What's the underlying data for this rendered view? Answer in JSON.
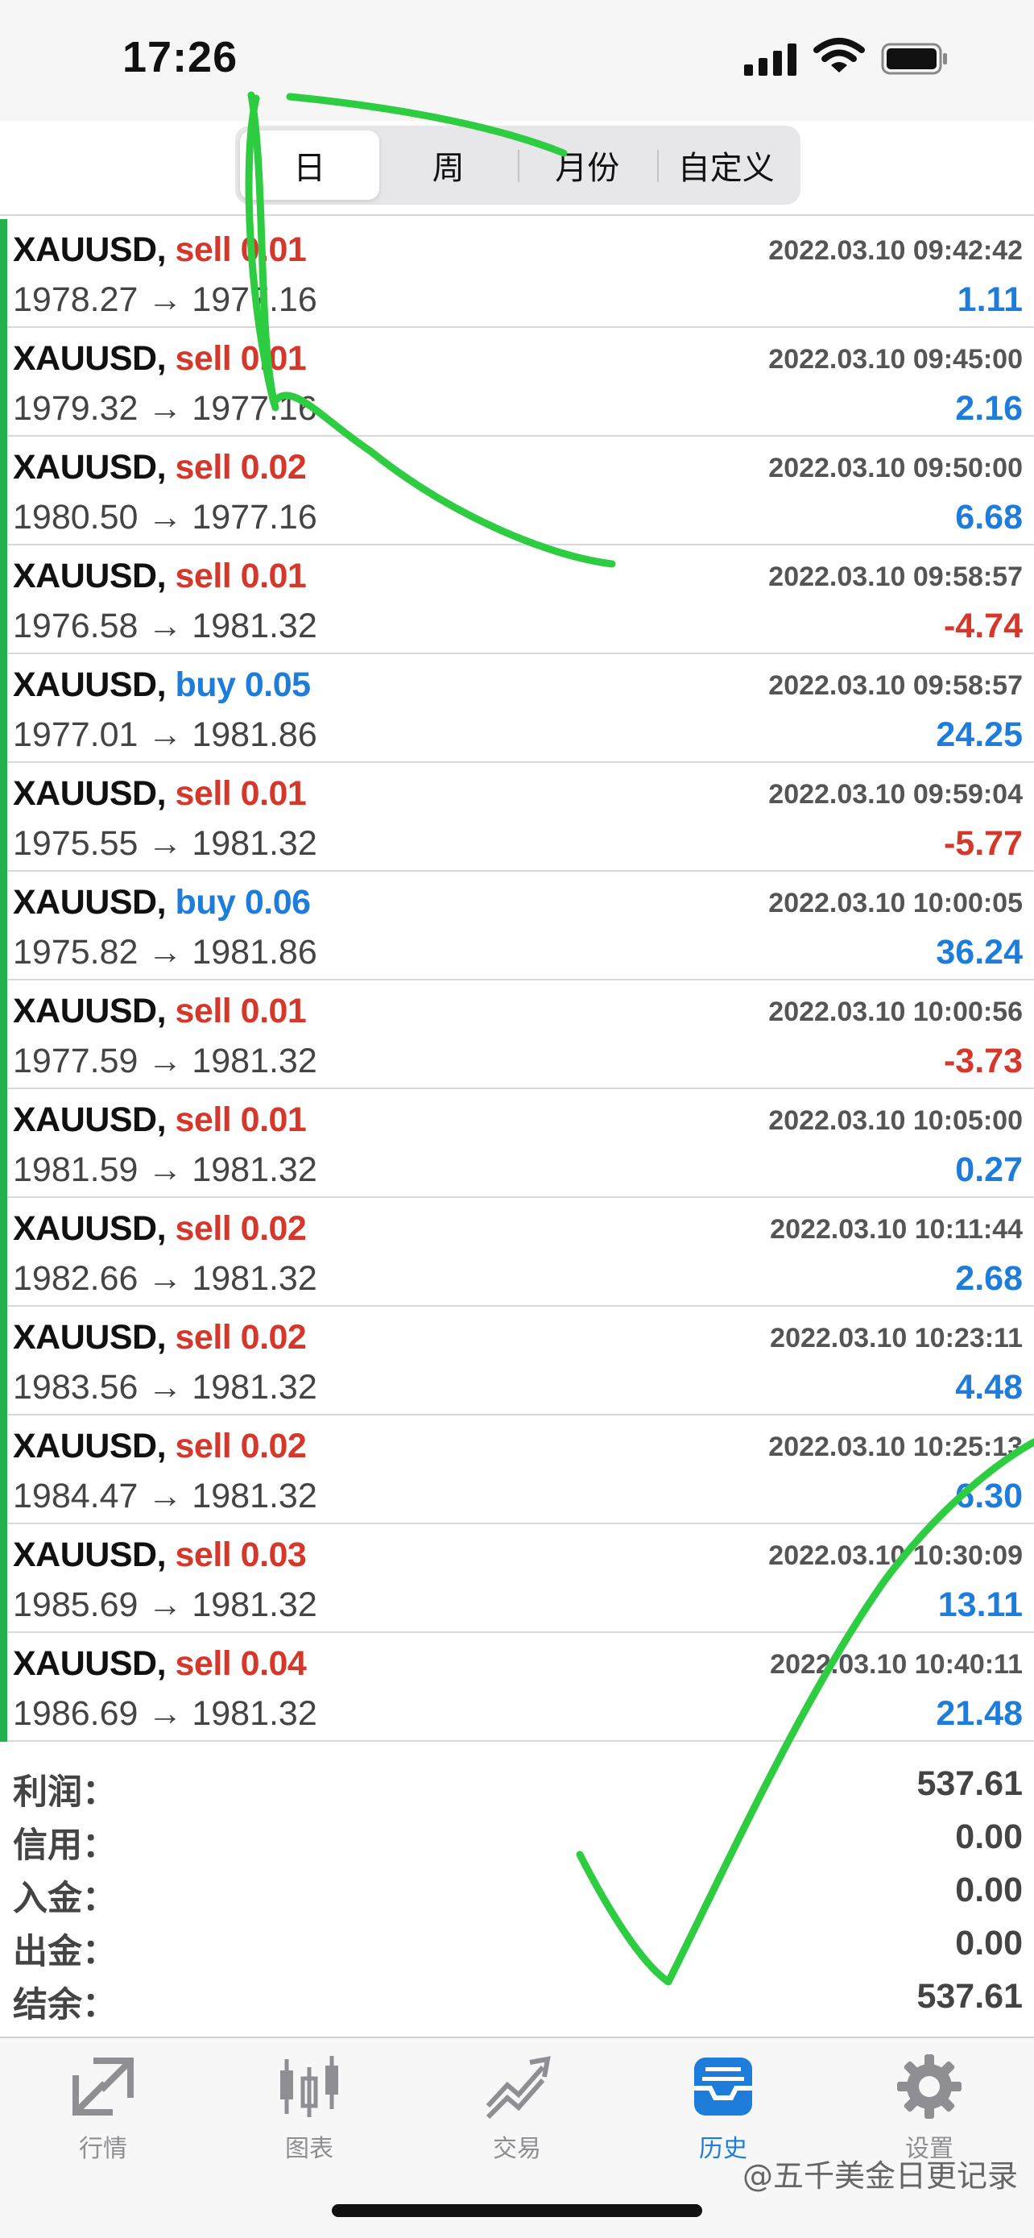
{
  "status_bar": {
    "time": "17:26"
  },
  "period_tabs": [
    {
      "label": "日",
      "active": true
    },
    {
      "label": "周",
      "active": false
    },
    {
      "label": "月份",
      "active": false
    },
    {
      "label": "自定义",
      "active": false
    }
  ],
  "trades": [
    {
      "symbol": "XAUUSD,",
      "side": "sell",
      "lots": "sell 0.01",
      "prices": "1978.27 → 1977.16",
      "time": "2022.03.10 09:42:42",
      "profit": "1.11"
    },
    {
      "symbol": "XAUUSD,",
      "side": "sell",
      "lots": "sell 0.01",
      "prices": "1979.32 → 1977.16",
      "time": "2022.03.10 09:45:00",
      "profit": "2.16"
    },
    {
      "symbol": "XAUUSD,",
      "side": "sell",
      "lots": "sell 0.02",
      "prices": "1980.50 → 1977.16",
      "time": "2022.03.10 09:50:00",
      "profit": "6.68"
    },
    {
      "symbol": "XAUUSD,",
      "side": "sell",
      "lots": "sell 0.01",
      "prices": "1976.58 → 1981.32",
      "time": "2022.03.10 09:58:57",
      "profit": "-4.74"
    },
    {
      "symbol": "XAUUSD,",
      "side": "buy",
      "lots": "buy 0.05",
      "prices": "1977.01 → 1981.86",
      "time": "2022.03.10 09:58:57",
      "profit": "24.25"
    },
    {
      "symbol": "XAUUSD,",
      "side": "sell",
      "lots": "sell 0.01",
      "prices": "1975.55 → 1981.32",
      "time": "2022.03.10 09:59:04",
      "profit": "-5.77"
    },
    {
      "symbol": "XAUUSD,",
      "side": "buy",
      "lots": "buy 0.06",
      "prices": "1975.82 → 1981.86",
      "time": "2022.03.10 10:00:05",
      "profit": "36.24"
    },
    {
      "symbol": "XAUUSD,",
      "side": "sell",
      "lots": "sell 0.01",
      "prices": "1977.59 → 1981.32",
      "time": "2022.03.10 10:00:56",
      "profit": "-3.73"
    },
    {
      "symbol": "XAUUSD,",
      "side": "sell",
      "lots": "sell 0.01",
      "prices": "1981.59 → 1981.32",
      "time": "2022.03.10 10:05:00",
      "profit": "0.27"
    },
    {
      "symbol": "XAUUSD,",
      "side": "sell",
      "lots": "sell 0.02",
      "prices": "1982.66 → 1981.32",
      "time": "2022.03.10 10:11:44",
      "profit": "2.68"
    },
    {
      "symbol": "XAUUSD,",
      "side": "sell",
      "lots": "sell 0.02",
      "prices": "1983.56 → 1981.32",
      "time": "2022.03.10 10:23:11",
      "profit": "4.48"
    },
    {
      "symbol": "XAUUSD,",
      "side": "sell",
      "lots": "sell 0.02",
      "prices": "1984.47 → 1981.32",
      "time": "2022.03.10 10:25:13",
      "profit": "6.30"
    },
    {
      "symbol": "XAUUSD,",
      "side": "sell",
      "lots": "sell 0.03",
      "prices": "1985.69 → 1981.32",
      "time": "2022.03.10 10:30:09",
      "profit": "13.11"
    },
    {
      "symbol": "XAUUSD,",
      "side": "sell",
      "lots": "sell 0.04",
      "prices": "1986.69 → 1981.32",
      "time": "2022.03.10 10:40:11",
      "profit": "21.48"
    }
  ],
  "summary": [
    {
      "label": "利润：",
      "value": "537.61"
    },
    {
      "label": "信用：",
      "value": "0.00"
    },
    {
      "label": "入金：",
      "value": "0.00"
    },
    {
      "label": "出金：",
      "value": "0.00"
    },
    {
      "label": "结余：",
      "value": "537.61"
    }
  ],
  "tab_bar": {
    "quotes": "行情",
    "chart": "图表",
    "trade": "交易",
    "history": "历史",
    "settings": "设置"
  },
  "watermark": "@五千美金日更记录",
  "colors": {
    "sell": "#d6372b",
    "buy": "#1e7ddb",
    "profit_positive": "#1e7ddb",
    "profit_negative": "#d6372b",
    "row_accent": "#22b14c",
    "tab_active": "#1e7ddb",
    "annotation": "#2ecc40"
  }
}
